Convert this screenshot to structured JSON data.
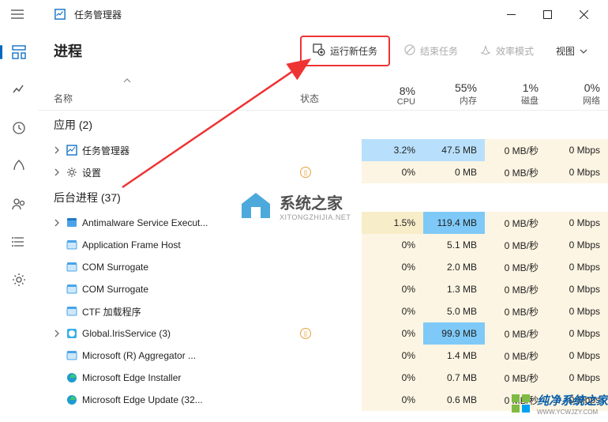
{
  "app": {
    "title": "任务管理器"
  },
  "page": {
    "title": "进程"
  },
  "toolbar": {
    "new_task": "运行新任务",
    "end_task": "结束任务",
    "efficiency": "效率模式",
    "view": "视图"
  },
  "columns": {
    "name": "名称",
    "status": "状态",
    "cpu": {
      "pct": "8%",
      "label": "CPU"
    },
    "mem": {
      "pct": "55%",
      "label": "内存"
    },
    "disk": {
      "pct": "1%",
      "label": "磁盘"
    },
    "net": {
      "pct": "0%",
      "label": "网络"
    }
  },
  "groups": {
    "apps": {
      "label": "应用 (2)"
    },
    "bg": {
      "label": "后台进程 (37)"
    }
  },
  "rows": [
    {
      "name": "任务管理器",
      "expand": true,
      "icon": "grid",
      "cpu": "3.2%",
      "mem": "47.5 MB",
      "disk": "0 MB/秒",
      "net": "0 Mbps",
      "cpu_c": "c2",
      "mem_c": "c2"
    },
    {
      "name": "设置",
      "expand": true,
      "icon": "gear",
      "paused": true,
      "cpu": "0%",
      "mem": "0 MB",
      "disk": "0 MB/秒",
      "net": "0 Mbps",
      "cpu_c": "c0",
      "mem_c": "c0"
    },
    {
      "name": "Antimalware Service Execut...",
      "expand": true,
      "icon": "shield",
      "cpu": "1.5%",
      "mem": "119.4 MB",
      "disk": "0 MB/秒",
      "net": "0 Mbps",
      "cpu_c": "c1",
      "mem_c": "c3"
    },
    {
      "name": "Application Frame Host",
      "icon": "app",
      "cpu": "0%",
      "mem": "5.1 MB",
      "disk": "0 MB/秒",
      "net": "0 Mbps",
      "cpu_c": "c0",
      "mem_c": "c0"
    },
    {
      "name": "COM Surrogate",
      "icon": "app",
      "cpu": "0%",
      "mem": "2.0 MB",
      "disk": "0 MB/秒",
      "net": "0 Mbps",
      "cpu_c": "c0",
      "mem_c": "c0"
    },
    {
      "name": "COM Surrogate",
      "icon": "app",
      "cpu": "0%",
      "mem": "1.3 MB",
      "disk": "0 MB/秒",
      "net": "0 Mbps",
      "cpu_c": "c0",
      "mem_c": "c0"
    },
    {
      "name": "CTF 加载程序",
      "icon": "app",
      "cpu": "0%",
      "mem": "5.0 MB",
      "disk": "0 MB/秒",
      "net": "0 Mbps",
      "cpu_c": "c0",
      "mem_c": "c0"
    },
    {
      "name": "Global.IrisService (3)",
      "expand": true,
      "icon": "globe",
      "paused": true,
      "cpu": "0%",
      "mem": "99.9 MB",
      "disk": "0 MB/秒",
      "net": "0 Mbps",
      "cpu_c": "c0",
      "mem_c": "c3"
    },
    {
      "name": "Microsoft (R) Aggregator ...",
      "icon": "app",
      "cpu": "0%",
      "mem": "1.4 MB",
      "disk": "0 MB/秒",
      "net": "0 Mbps",
      "cpu_c": "c0",
      "mem_c": "c0"
    },
    {
      "name": "Microsoft Edge Installer",
      "icon": "edge",
      "cpu": "0%",
      "mem": "0.7 MB",
      "disk": "0 MB/秒",
      "net": "0 Mbps",
      "cpu_c": "c0",
      "mem_c": "c0"
    },
    {
      "name": "Microsoft Edge Update (32...",
      "icon": "edge",
      "cpu": "0%",
      "mem": "0.6 MB",
      "disk": "0 MB/秒",
      "net": "0 Mbps",
      "cpu_c": "c0",
      "mem_c": "c0"
    }
  ],
  "watermark1": {
    "t1": "系统之家",
    "t2": "XITONGZHIJIA.NET"
  },
  "watermark2": {
    "t1": "纯净系统之家",
    "t2": "WWW.YCWJZY.COM"
  }
}
